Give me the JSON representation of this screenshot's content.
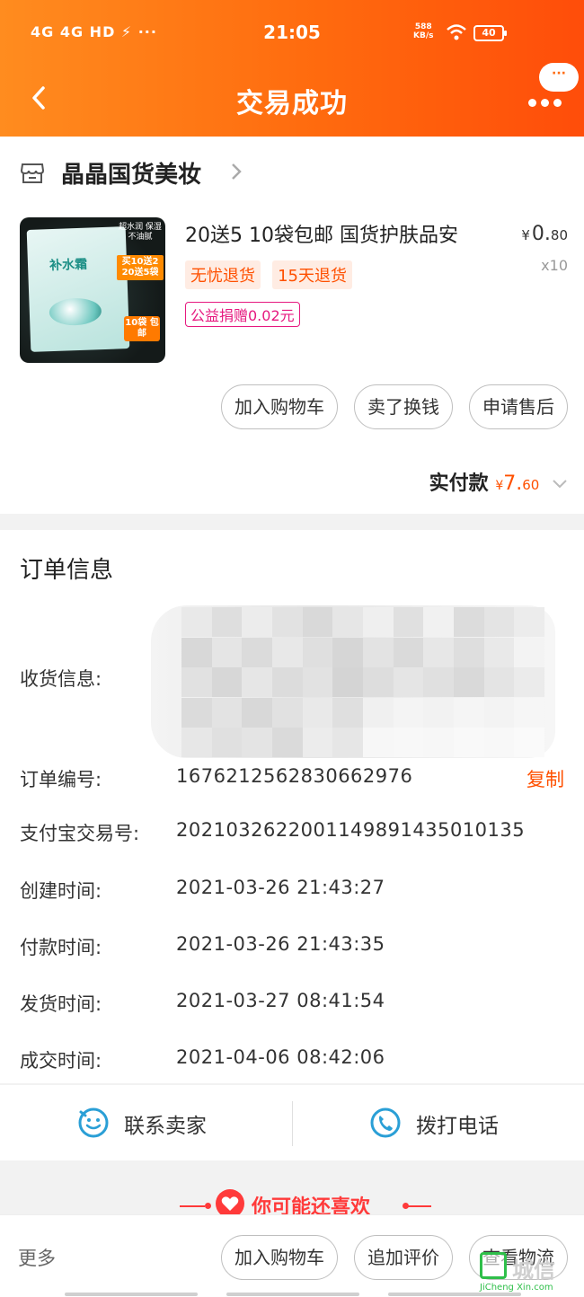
{
  "status_bar": {
    "network": "4G 4G HD ⚡ ···",
    "time": "21:05",
    "speed_value": "588",
    "speed_unit": "KB/s",
    "battery": "40"
  },
  "nav": {
    "title": "交易成功",
    "bubble": "···"
  },
  "shop": {
    "name": "晶晶国货美妆"
  },
  "product": {
    "title": "20送5 10袋包邮 国货护肤品安",
    "price_symbol": "¥",
    "price_int": "0.",
    "price_dec": "80",
    "quantity": "x10",
    "badges": [
      "无忧退货",
      "15天退货"
    ],
    "charity": "公益捐赠0.02元",
    "image_texts": {
      "pack_title": "补水霜",
      "top_tag": "超水润 保湿 不油腻",
      "promo": "买10送2 20送5袋",
      "bag": "10袋 包邮"
    }
  },
  "actions": {
    "add_cart": "加入购物车",
    "resell": "卖了换钱",
    "after_sale": "申请售后"
  },
  "payment": {
    "label": "实付款",
    "symbol": "¥",
    "int": "7.",
    "dec": "60"
  },
  "order_info": {
    "title": "订单信息",
    "rows": [
      {
        "label": "收货信息:",
        "value": ""
      },
      {
        "label": "订单编号:",
        "value": "1676212562830662976"
      },
      {
        "label": "支付宝交易号:",
        "value": "2021032622001149891435010135"
      },
      {
        "label": "创建时间:",
        "value": "2021-03-26 21:43:27"
      },
      {
        "label": "付款时间:",
        "value": "2021-03-26 21:43:35"
      },
      {
        "label": "发货时间:",
        "value": "2021-03-27 08:41:54"
      },
      {
        "label": "成交时间:",
        "value": "2021-04-06 08:42:06"
      }
    ],
    "copy": "复制"
  },
  "contact": {
    "seller": "联系卖家",
    "phone": "拨打电话"
  },
  "recommend": {
    "title": "你可能还喜欢"
  },
  "bottom_bar": {
    "more": "更多",
    "add_cart": "加入购物车",
    "review": "追加评价",
    "logistics": "查看物流"
  },
  "watermark": {
    "text": "城信",
    "sub": "JiCheng Xin.com"
  },
  "colors": {
    "header_start": "#ff8c1f",
    "header_end": "#ff4d0a",
    "accent": "#ff5000",
    "charity": "#e6197f",
    "icon_blue": "#2a9fd6"
  }
}
